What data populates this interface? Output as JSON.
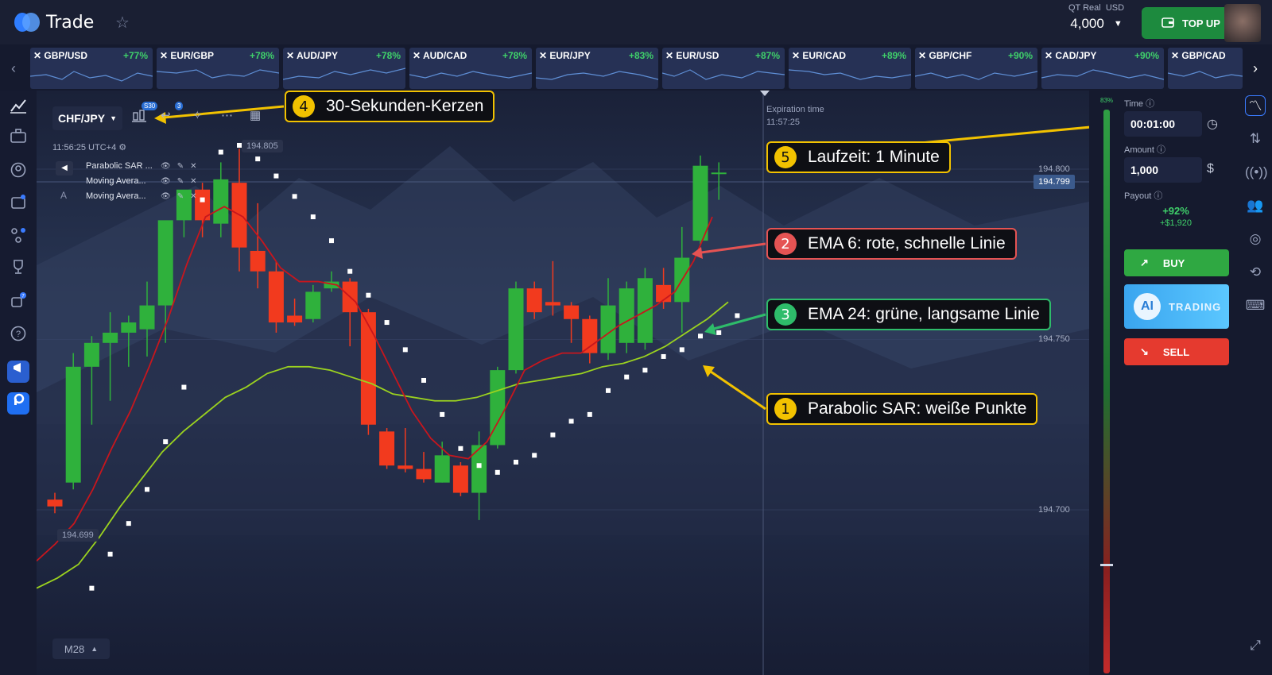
{
  "header": {
    "app_name": "Trade",
    "account_label": "QT Real",
    "currency": "USD",
    "balance": "4,000",
    "topup_label": "TOP UP"
  },
  "tickers": [
    {
      "symbol": "GBP/USD",
      "payout": "+77%"
    },
    {
      "symbol": "EUR/GBP",
      "payout": "+78%"
    },
    {
      "symbol": "AUD/JPY",
      "payout": "+78%"
    },
    {
      "symbol": "AUD/CAD",
      "payout": "+78%"
    },
    {
      "symbol": "EUR/JPY",
      "payout": "+83%"
    },
    {
      "symbol": "EUR/USD",
      "payout": "+87%"
    },
    {
      "symbol": "EUR/CAD",
      "payout": "+89%"
    },
    {
      "symbol": "GBP/CHF",
      "payout": "+90%"
    },
    {
      "symbol": "CAD/JPY",
      "payout": "+90%"
    },
    {
      "symbol": "GBP/CAD",
      "payout": ""
    }
  ],
  "chart": {
    "pair": "CHF/JPY",
    "candle_badge": "S30",
    "tool_badge": "3",
    "clock": "11:56:25 UTC+4",
    "high_label": "194.805",
    "low_label": "194.699",
    "current_price": "194.799",
    "indicators": [
      {
        "name": "Parabolic SAR ..."
      },
      {
        "name": "Moving Avera..."
      },
      {
        "name": "Moving Avera..."
      }
    ],
    "indicator_letter": "A",
    "expiration_label": "Expiration time",
    "expiration_time": "11:57:25",
    "timeframe": "M28",
    "price_levels": [
      "194.800",
      "194.750",
      "194.700"
    ]
  },
  "callouts": [
    {
      "num": "4",
      "text": "30-Sekunden-Kerzen",
      "color": "#f2c200"
    },
    {
      "num": "5",
      "text": "Laufzeit: 1 Minute",
      "color": "#f2c200"
    },
    {
      "num": "2",
      "text": "EMA 6: rote, schnelle Linie",
      "color": "#e55353"
    },
    {
      "num": "3",
      "text": "EMA 24: grüne, langsame Linie",
      "color": "#2ebc6a"
    },
    {
      "num": "1",
      "text": "Parabolic SAR: weiße Punkte",
      "color": "#f2c200"
    }
  ],
  "trade_panel": {
    "sentiment_pct": "83%",
    "time_label": "Time",
    "time_value": "00:01:00",
    "amount_label": "Amount",
    "amount_value": "1,000",
    "payout_label": "Payout",
    "payout_pct": "+92%",
    "payout_amount": "+$1,920",
    "buy_label": "BUY",
    "ai_label": "AI",
    "trading_label": "TRADING",
    "sell_label": "SELL"
  },
  "colors": {
    "bull": "#2fb13c",
    "bear": "#f23a1e",
    "ema_fast": "#c8161d",
    "ema_slow": "#9bd21f",
    "sar": "#ffffff"
  },
  "chart_data": {
    "type": "candlestick",
    "symbol": "CHF/JPY",
    "y_ticks": [
      194.7,
      194.75,
      194.8
    ],
    "candles": [
      {
        "o": 194.703,
        "h": 194.705,
        "c": 194.701,
        "l": 194.699
      },
      {
        "o": 194.708,
        "h": 194.746,
        "c": 194.742,
        "l": 194.706
      },
      {
        "o": 194.742,
        "h": 194.751,
        "c": 194.749,
        "l": 194.725
      },
      {
        "o": 194.749,
        "h": 194.758,
        "c": 194.752,
        "l": 194.732
      },
      {
        "o": 194.752,
        "h": 194.757,
        "c": 194.755,
        "l": 194.742
      },
      {
        "o": 194.753,
        "h": 194.767,
        "c": 194.76,
        "l": 194.745
      },
      {
        "o": 194.76,
        "h": 194.784,
        "c": 194.785,
        "l": 194.749
      },
      {
        "o": 194.785,
        "h": 194.793,
        "c": 194.794,
        "l": 194.78
      },
      {
        "o": 194.794,
        "h": 194.796,
        "c": 194.785,
        "l": 194.78
      },
      {
        "o": 194.784,
        "h": 194.802,
        "c": 194.797,
        "l": 194.78
      },
      {
        "o": 194.796,
        "h": 194.806,
        "c": 194.777,
        "l": 194.77
      },
      {
        "o": 194.776,
        "h": 194.79,
        "c": 194.77,
        "l": 194.765
      },
      {
        "o": 194.77,
        "h": 194.773,
        "c": 194.755,
        "l": 194.752
      },
      {
        "o": 194.757,
        "h": 194.762,
        "c": 194.755,
        "l": 194.754
      },
      {
        "o": 194.756,
        "h": 194.766,
        "c": 194.764,
        "l": 194.755
      },
      {
        "o": 194.765,
        "h": 194.77,
        "c": 194.767,
        "l": 194.764
      },
      {
        "o": 194.767,
        "h": 194.768,
        "c": 194.758,
        "l": 194.748
      },
      {
        "o": 194.758,
        "h": 194.759,
        "c": 194.725,
        "l": 194.722
      },
      {
        "o": 194.723,
        "h": 194.724,
        "c": 194.713,
        "l": 194.712
      },
      {
        "o": 194.713,
        "h": 194.724,
        "c": 194.712,
        "l": 194.711
      },
      {
        "o": 194.712,
        "h": 194.717,
        "c": 194.709,
        "l": 194.708
      },
      {
        "o": 194.708,
        "h": 194.72,
        "c": 194.716,
        "l": 194.708
      },
      {
        "o": 194.713,
        "h": 194.714,
        "c": 194.705,
        "l": 194.704
      },
      {
        "o": 194.705,
        "h": 194.723,
        "c": 194.719,
        "l": 194.697
      },
      {
        "o": 194.719,
        "h": 194.742,
        "c": 194.741,
        "l": 194.718
      },
      {
        "o": 194.741,
        "h": 194.767,
        "c": 194.765,
        "l": 194.74
      },
      {
        "o": 194.765,
        "h": 194.767,
        "c": 194.758,
        "l": 194.756
      },
      {
        "o": 194.761,
        "h": 194.773,
        "c": 194.76,
        "l": 194.757
      },
      {
        "o": 194.76,
        "h": 194.761,
        "c": 194.756,
        "l": 194.749
      },
      {
        "o": 194.756,
        "h": 194.757,
        "c": 194.746,
        "l": 194.743
      },
      {
        "o": 194.746,
        "h": 194.768,
        "c": 194.76,
        "l": 194.744
      },
      {
        "o": 194.749,
        "h": 194.767,
        "c": 194.765,
        "l": 194.746
      },
      {
        "o": 194.749,
        "h": 194.771,
        "c": 194.768,
        "l": 194.747
      },
      {
        "o": 194.766,
        "h": 194.771,
        "c": 194.761,
        "l": 194.759
      },
      {
        "o": 194.761,
        "h": 194.783,
        "c": 194.774,
        "l": 194.752
      },
      {
        "o": 194.779,
        "h": 194.804,
        "c": 194.801,
        "l": 194.778
      },
      {
        "o": 194.799,
        "h": 194.802,
        "c": 194.799,
        "l": 194.791
      }
    ],
    "ema_fast": [
      194.685,
      194.69,
      194.696,
      194.706,
      194.718,
      194.729,
      194.742,
      194.756,
      194.772,
      194.786,
      194.789,
      194.786,
      194.779,
      194.771,
      194.767,
      194.767,
      194.766,
      194.761,
      194.751,
      194.74,
      194.729,
      194.721,
      194.716,
      194.715,
      194.72,
      194.73,
      194.741,
      194.744,
      194.746,
      194.746,
      194.75,
      194.754,
      194.757,
      194.76,
      194.764,
      194.773,
      194.786
    ],
    "ema_slow": [
      194.677,
      194.68,
      194.684,
      194.692,
      194.701,
      194.709,
      194.717,
      194.723,
      194.728,
      194.733,
      194.736,
      194.74,
      194.742,
      194.742,
      194.741,
      194.739,
      194.737,
      194.734,
      194.733,
      194.732,
      194.732,
      194.733,
      194.735,
      194.737,
      194.738,
      194.739,
      194.74,
      194.742,
      194.743,
      194.745,
      194.748,
      194.752,
      194.756,
      194.761
    ],
    "sar": [
      null,
      null,
      194.677,
      194.687,
      194.696,
      194.706,
      194.72,
      194.736,
      194.791,
      194.805,
      194.807,
      194.803,
      194.798,
      194.792,
      194.786,
      194.779,
      194.77,
      194.763,
      194.755,
      194.747,
      194.738,
      194.728,
      194.718,
      194.713,
      194.711,
      194.714,
      194.716,
      194.722,
      194.726,
      194.728,
      194.735,
      194.739,
      194.741,
      194.745,
      194.747,
      194.751,
      194.752,
      194.757
    ]
  }
}
